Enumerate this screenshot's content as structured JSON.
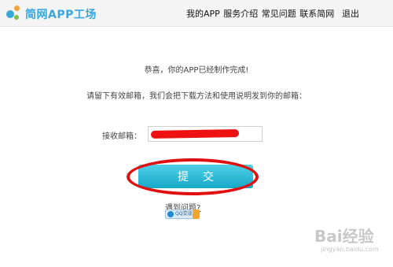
{
  "header": {
    "brand": "简网APP工场",
    "nav": {
      "my_app": "我的APP",
      "services": "服务介绍",
      "faq": "常见问题",
      "contact": "联系简网",
      "logout": "退出"
    }
  },
  "main": {
    "congrats": "恭喜，你的APP已经制作完成!",
    "email_prompt": "请留下有效邮箱，我们会把下载方法和使用说明发到你的邮箱：",
    "receive_label": "接收邮箱：",
    "submit_label": "提交",
    "help_link": "遇到问题?",
    "qq_badge": "QQ交谈"
  },
  "watermark": {
    "text": "Bai经验",
    "sub": "jingyan.baidu.com"
  },
  "colors": {
    "brand": "#3aa6d9",
    "button": "#17a9c9",
    "annotation": "#e01010"
  }
}
